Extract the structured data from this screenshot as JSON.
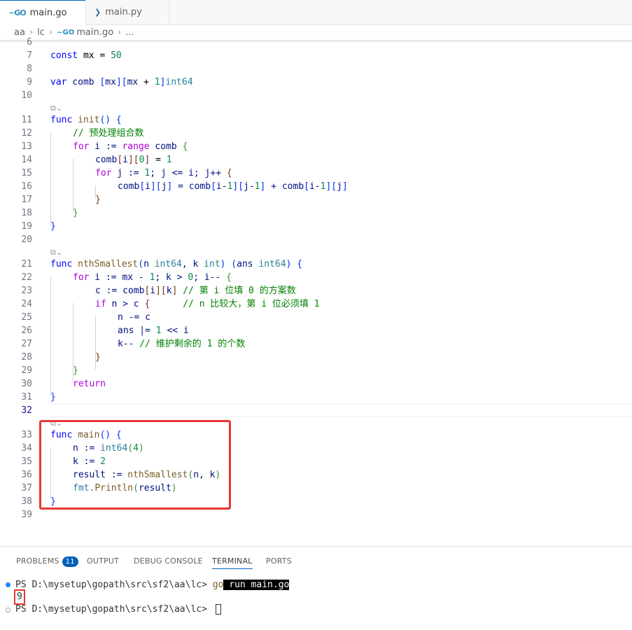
{
  "tabs": [
    {
      "icon": "go-file-icon",
      "icon_text": "~GO",
      "label": "main.go",
      "active": true
    },
    {
      "icon": "python-file-icon",
      "icon_text": "❯",
      "label": "main.py",
      "active": false
    }
  ],
  "breadcrumb": {
    "items": [
      "aa",
      "lc",
      "main.go",
      "..."
    ],
    "file_icon_text": "~GO"
  },
  "editor": {
    "top_partial_line_number": "6",
    "lines": [
      {
        "num": "7"
      },
      {
        "num": "8"
      },
      {
        "num": "9"
      },
      {
        "num": "10"
      },
      {
        "num": "11"
      },
      {
        "num": "12"
      },
      {
        "num": "13"
      },
      {
        "num": "14"
      },
      {
        "num": "15"
      },
      {
        "num": "16"
      },
      {
        "num": "17"
      },
      {
        "num": "18"
      },
      {
        "num": "19"
      },
      {
        "num": "20"
      },
      {
        "num": "21"
      },
      {
        "num": "22"
      },
      {
        "num": "23"
      },
      {
        "num": "24"
      },
      {
        "num": "25"
      },
      {
        "num": "26"
      },
      {
        "num": "27"
      },
      {
        "num": "28"
      },
      {
        "num": "29"
      },
      {
        "num": "30"
      },
      {
        "num": "31"
      },
      {
        "num": "32"
      },
      {
        "num": "33"
      },
      {
        "num": "34"
      },
      {
        "num": "35"
      },
      {
        "num": "36"
      },
      {
        "num": "37"
      },
      {
        "num": "38"
      },
      {
        "num": "39"
      }
    ],
    "code_lens": "⧉⌄",
    "code": {
      "l7": [
        "const",
        " mx = ",
        "50"
      ],
      "l9": [
        "var",
        " comb ",
        "[",
        "mx",
        "][",
        "mx",
        " + ",
        "1",
        "]",
        "int64"
      ],
      "l11": [
        "func",
        " ",
        "init",
        "()",
        " {"
      ],
      "l12": [
        "// 预处理组合数"
      ],
      "l13": [
        "for",
        " i := ",
        "range",
        " comb ",
        "{"
      ],
      "l14": [
        "comb",
        "[",
        "i",
        "][",
        "0",
        "]",
        " = ",
        "1"
      ],
      "l15": [
        "for",
        " j := ",
        "1",
        "; j <= i; j++ ",
        "{"
      ],
      "l16": [
        "comb",
        "[",
        "i",
        "][",
        "j",
        "]",
        " = comb",
        "[",
        "i-",
        "1",
        "][",
        "j-",
        "1",
        "]",
        " + comb",
        "[",
        "i-",
        "1",
        "][",
        "j",
        "]"
      ],
      "l17": [
        "}"
      ],
      "l18": [
        "}"
      ],
      "l19": [
        "}"
      ],
      "l21": [
        "func",
        " ",
        "nthSmallest",
        "(",
        "n ",
        "int64",
        ", k ",
        "int",
        ")",
        " (",
        "ans ",
        "int64",
        ")",
        " {"
      ],
      "l22": [
        "for",
        " i := mx - ",
        "1",
        "; k > ",
        "0",
        "; i-- ",
        "{"
      ],
      "l23": [
        "c := comb",
        "[",
        "i",
        "][",
        "k",
        "]",
        " ",
        "// 第 i 位填 0 的方案数"
      ],
      "l24": [
        "if",
        " n > c ",
        "{",
        "      ",
        "// n 比较大，第 i 位必须填 1"
      ],
      "l25": [
        "n -= c"
      ],
      "l26": [
        "ans |= ",
        "1",
        " << i"
      ],
      "l27": [
        "k-- ",
        "// 维护剩余的 1 的个数"
      ],
      "l28": [
        "}"
      ],
      "l29": [
        "}"
      ],
      "l30": [
        "return"
      ],
      "l31": [
        "}"
      ],
      "l33": [
        "func",
        " ",
        "main",
        "()",
        " {"
      ],
      "l34": [
        "n := ",
        "int64",
        "(",
        "4",
        ")"
      ],
      "l35": [
        "k := ",
        "2"
      ],
      "l36": [
        "result := ",
        "nthSmallest",
        "(",
        "n, k",
        ")"
      ],
      "l37": [
        "fmt.",
        "Println",
        "(",
        "result",
        ")"
      ],
      "l38": [
        "}"
      ]
    }
  },
  "panel": {
    "tabs": [
      {
        "label": "PROBLEMS",
        "badge": "11"
      },
      {
        "label": "OUTPUT"
      },
      {
        "label": "DEBUG CONSOLE"
      },
      {
        "label": "TERMINAL",
        "active": true
      },
      {
        "label": "PORTS"
      }
    ],
    "terminal": {
      "prompt1": "PS D:\\mysetup\\gopath\\src\\sf2\\aa\\lc> ",
      "cmd_go": "go",
      "cmd_rest": " run main.go",
      "output": "9",
      "prompt2": "PS D:\\mysetup\\gopath\\src\\sf2\\aa\\lc> "
    }
  },
  "colors": {
    "accent": "#005fb8",
    "highlight_box": "#e53935",
    "keyword": "#0000ff",
    "control": "#af00db",
    "function": "#795e26",
    "type": "#267f99",
    "number": "#098658",
    "comment": "#008000"
  }
}
